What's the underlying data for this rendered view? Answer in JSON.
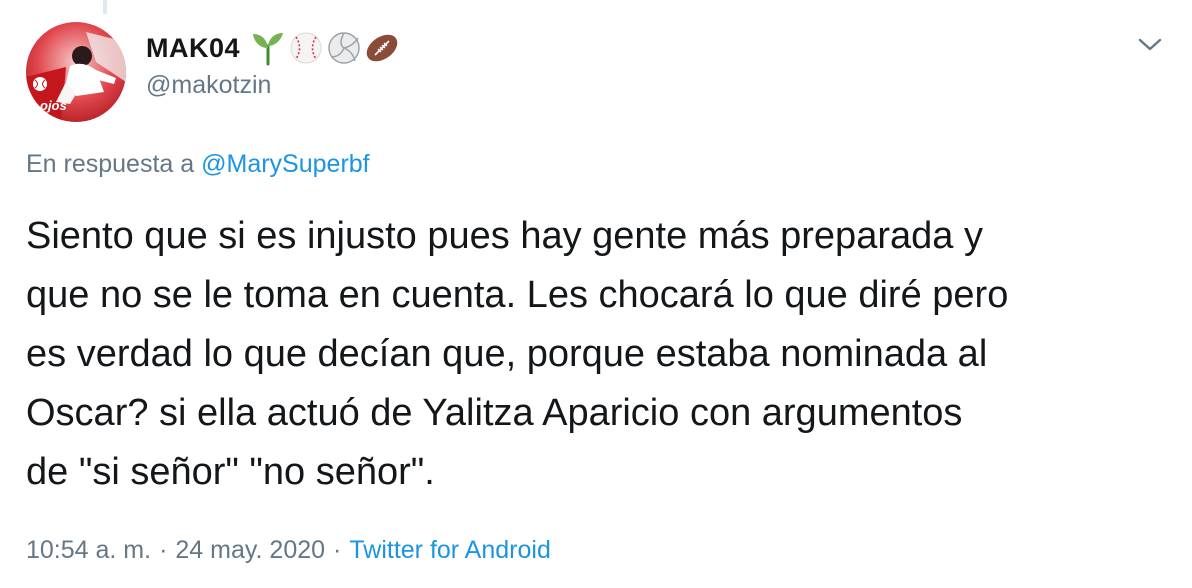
{
  "user": {
    "display_name": "MAK04",
    "name_emojis": [
      "seedling-emoji",
      "baseball-emoji",
      "volleyball-emoji",
      "football-emoji"
    ],
    "handle": "@makotzin",
    "avatar_overlay_text": "ojos"
  },
  "reply": {
    "prefix": "En respuesta a",
    "mention": "@MarySuperbf"
  },
  "tweet": {
    "lines": [
      "Siento que si es injusto pues hay gente más preparada y",
      "que no se le toma en cuenta. Les chocará lo que diré pero",
      "es verdad lo que decían que, porque estaba nominada al",
      "Oscar? si ella actuó de Yalitza Aparicio con argumentos",
      "de \"si señor\" \"no señor\"."
    ]
  },
  "meta": {
    "time": "10:54 a. m.",
    "separator": "·",
    "date": "24 may. 2020",
    "source": "Twitter for Android"
  },
  "icons": {
    "menu": "chevron-down-icon"
  },
  "colors": {
    "text": "#14171a",
    "secondary": "#657786",
    "link": "#1b95e0"
  }
}
